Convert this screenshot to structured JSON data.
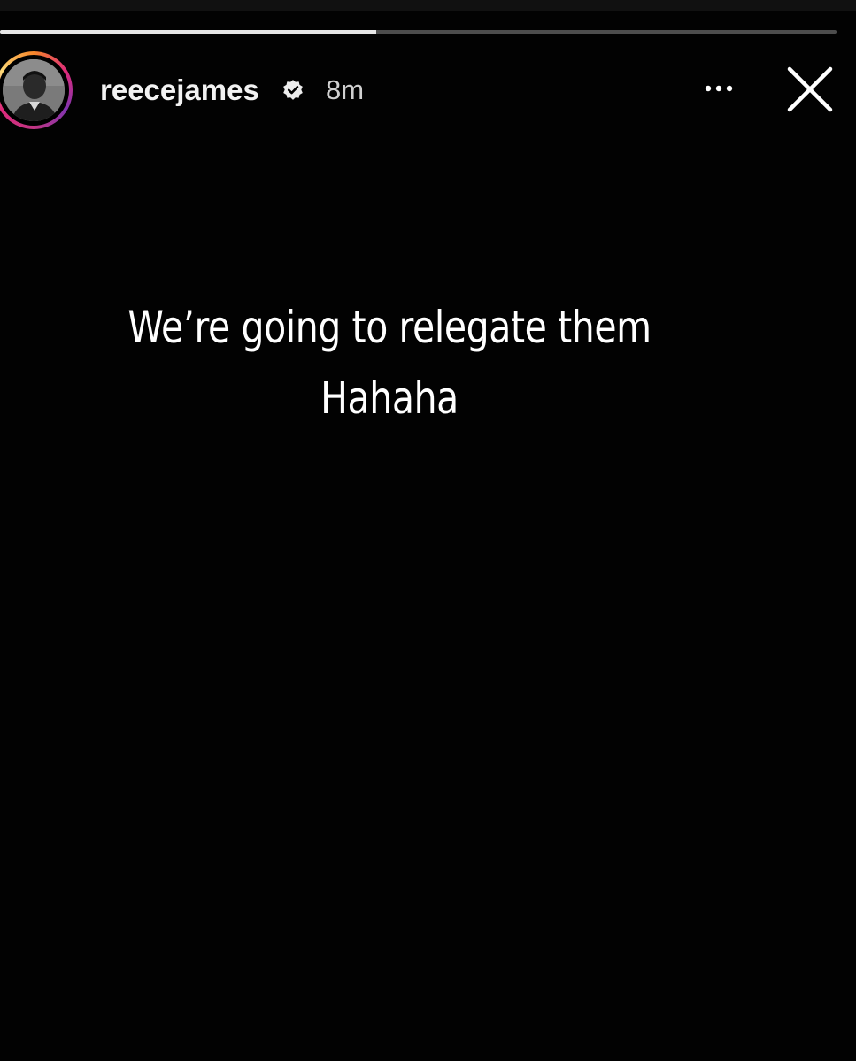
{
  "story": {
    "username": "reecejames",
    "verified": true,
    "timestamp": "8m",
    "progress": 0.45,
    "caption_lines": [
      "We’re going to relegate them",
      "Hahaha"
    ]
  },
  "icons": {
    "verified": "verified-badge-icon",
    "more": "more-options-icon",
    "close": "close-icon"
  },
  "colors": {
    "background": "#020202",
    "text": "#ffffff",
    "progress_filled": "#e6e6e6",
    "progress_track": "#4d4d4d",
    "ring_gradient": [
      "#f58529",
      "#dd2a7b",
      "#8134af",
      "#feda77"
    ]
  }
}
